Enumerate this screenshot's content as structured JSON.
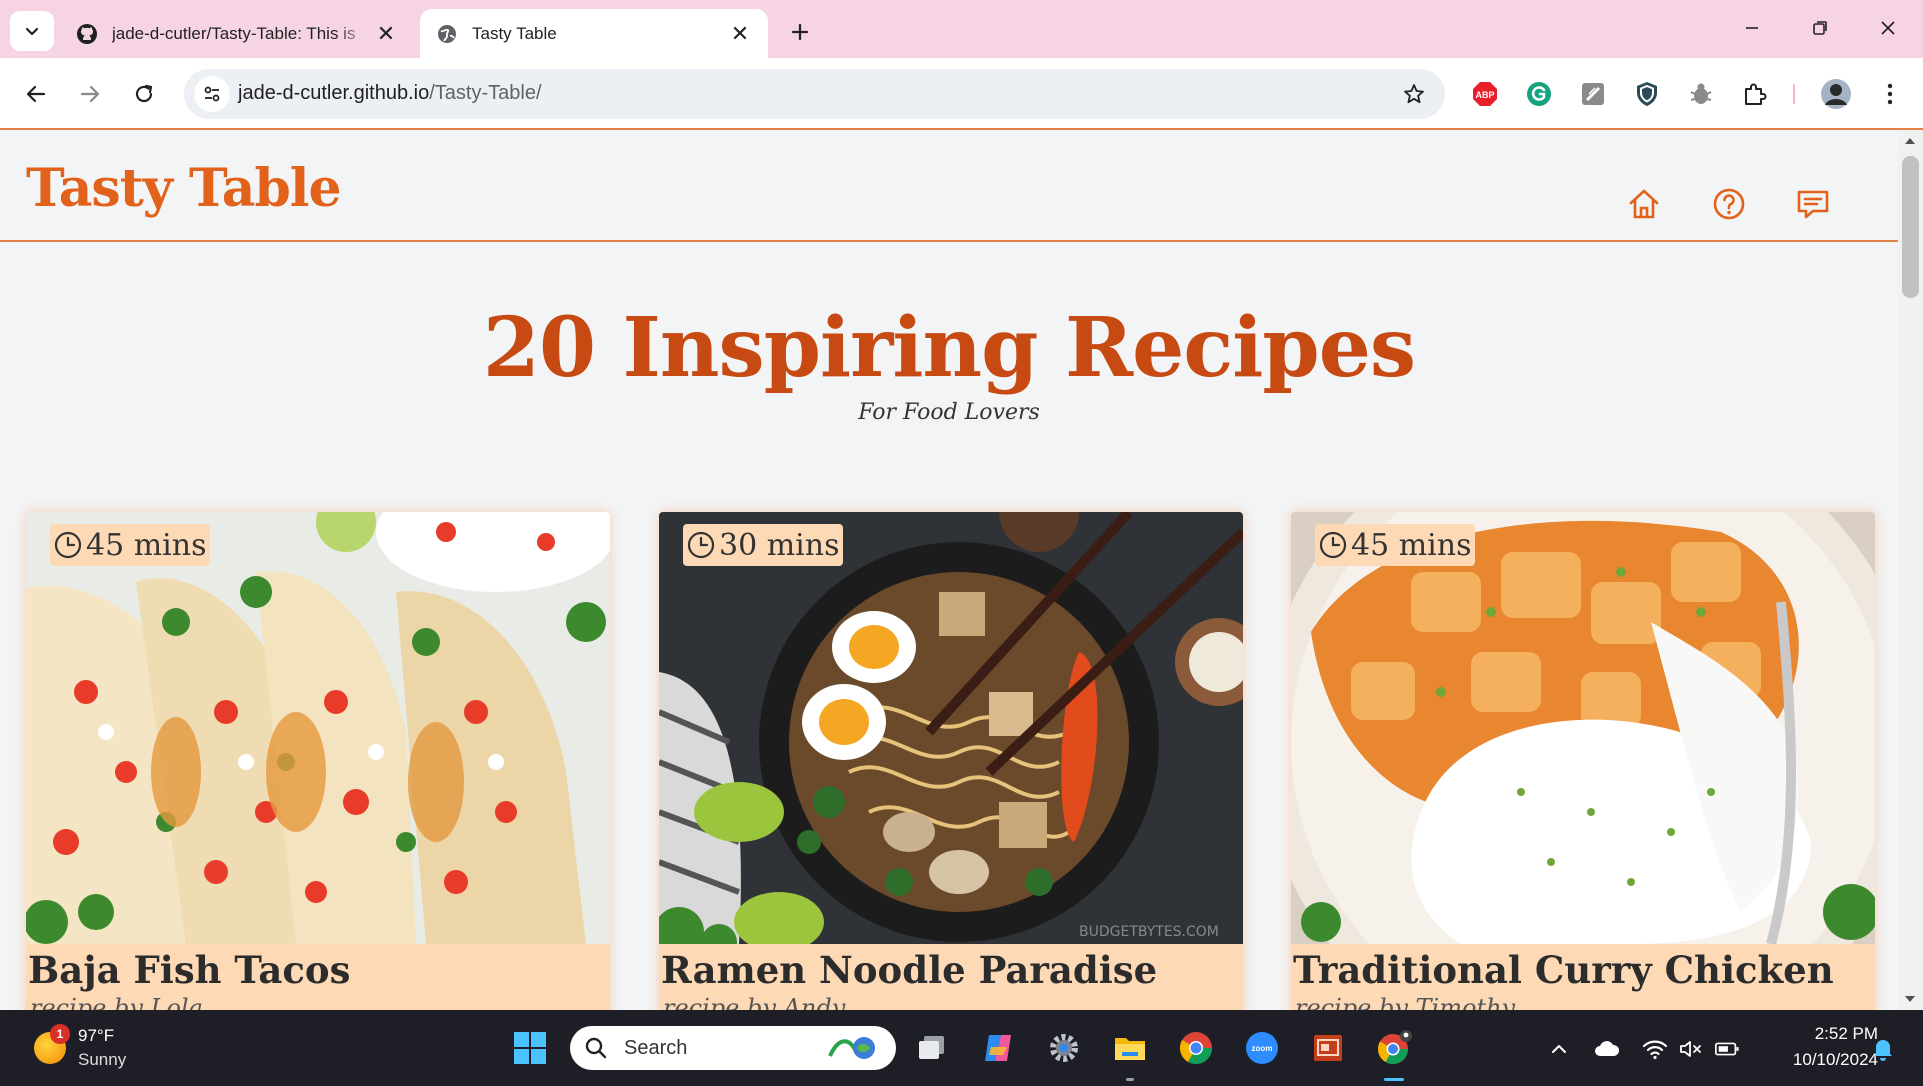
{
  "browser": {
    "tabs": [
      {
        "title": "jade-d-cutler/Tasty-Table: This is",
        "active": false
      },
      {
        "title": "Tasty Table",
        "active": true
      }
    ],
    "url_host": "jade-d-cutler.github.io",
    "url_path": "/Tasty-Table/"
  },
  "site": {
    "logo": "Tasty Table",
    "nav": [
      "home-icon",
      "help-icon",
      "comment-icon"
    ],
    "accent": "#e2611b"
  },
  "hero": {
    "title": "20 Inspiring Recipes",
    "subtitle": "For Food Lovers"
  },
  "recipes": [
    {
      "name": "Baja Fish Tacos",
      "time": "45 mins",
      "author": "recipe by Lola"
    },
    {
      "name": "Ramen Noodle Paradise",
      "time": "30 mins",
      "author": "recipe by Andy"
    },
    {
      "name": "Traditional Curry Chicken",
      "time": "45 mins",
      "author": "recipe by Timothy"
    }
  ],
  "taskbar": {
    "weather_badge": "1",
    "weather_temp": "97°F",
    "weather_desc": "Sunny",
    "search_label": "Search",
    "time": "2:52 PM",
    "date": "10/10/2024"
  }
}
